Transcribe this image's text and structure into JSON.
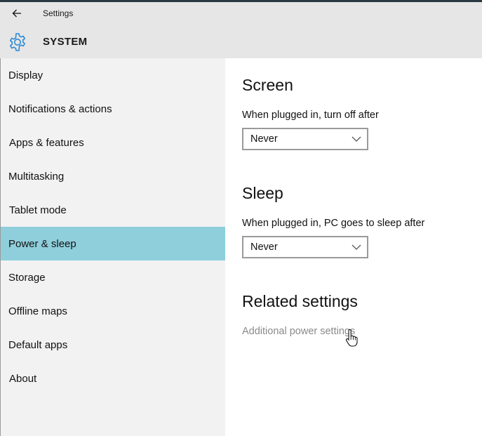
{
  "window": {
    "title": "Settings"
  },
  "header": {
    "section_title": "SYSTEM"
  },
  "sidebar": {
    "items": [
      {
        "label": "Display"
      },
      {
        "label": "Notifications & actions"
      },
      {
        "label": "Apps & features"
      },
      {
        "label": "Multitasking"
      },
      {
        "label": "Tablet mode"
      },
      {
        "label": "Power & sleep",
        "selected": true
      },
      {
        "label": "Storage"
      },
      {
        "label": "Offline maps"
      },
      {
        "label": "Default apps"
      },
      {
        "label": "About"
      }
    ]
  },
  "main": {
    "screen": {
      "heading": "Screen",
      "label": "When plugged in, turn off after",
      "value": "Never"
    },
    "sleep": {
      "heading": "Sleep",
      "label": "When plugged in, PC goes to sleep after",
      "value": "Never"
    },
    "related": {
      "heading": "Related settings",
      "link": "Additional power settings"
    }
  },
  "colors": {
    "selected_bg": "#8fcfdc",
    "accent": "#2b8ad8",
    "sidebar_bg": "#f2f2f2",
    "header_bg": "#e6e6e6",
    "link": "#8a8a8a"
  },
  "icons": {
    "back": "back-arrow-icon",
    "system": "gear-icon",
    "dropdown": "chevron-down-icon",
    "pointer": "hand-pointer-icon"
  }
}
